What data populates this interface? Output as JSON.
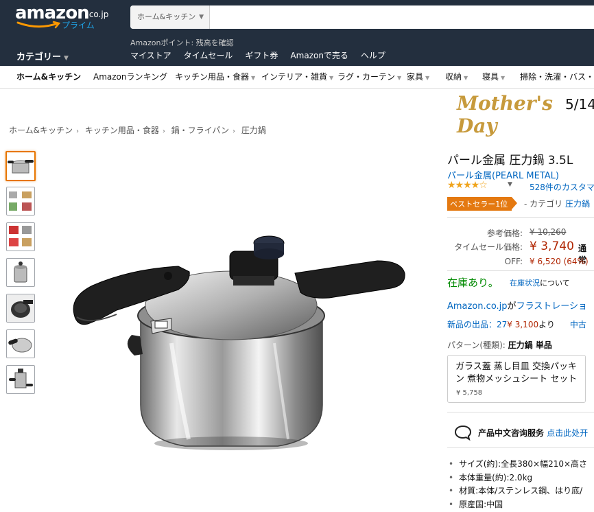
{
  "header": {
    "logo_word": "amazon",
    "logo_tld": ".co.jp",
    "logo_prime": "プライム",
    "search_department": "ホーム&キッチン",
    "search_placeholder": "",
    "points_text": "Amazonポイント: 残高を確認",
    "category_label": "カテゴリー",
    "nav_links": [
      "マイストア",
      "タイムセール",
      "ギフト券",
      "Amazonで売る",
      "ヘルプ"
    ]
  },
  "subnav": {
    "items": [
      "ホーム&キッチン",
      "Amazonランキング",
      "キッチン用品・食器",
      "インテリア・雑貨",
      "ラグ・カーテン",
      "家具",
      "収納",
      "寝具",
      "掃除・洗濯・バス・トイ"
    ]
  },
  "banner": {
    "title": "Mother's Day",
    "date": "5/14"
  },
  "breadcrumb": [
    "ホーム&キッチン",
    "キッチン用品・食器",
    "鍋・フライパン",
    "圧力鍋"
  ],
  "product": {
    "title": "パール金属 圧力鍋 3.5L",
    "brand": "パール金属(PEARL METAL)",
    "rating": 4.0,
    "stars_filled": "★★★★",
    "stars_empty": "☆",
    "review_count": "528件のカスタマ",
    "bestseller_badge": "ベストセラー1位",
    "bestseller_category_prefix": "- カテゴリ",
    "bestseller_category": "圧力鍋",
    "list_price_label": "参考価格:",
    "list_price": "¥ 10,260",
    "sale_price_label": "タイムセール価格:",
    "sale_price": "¥ 3,740",
    "regular_text": "通常",
    "off_label": "OFF:",
    "off_value": "¥ 6,520 (64%)",
    "stock_text": "在庫あり。",
    "stock_link": "在庫状況",
    "stock_suffix": "について",
    "frustration_prefix": "Amazon.co.jp",
    "frustration_mid": "が",
    "frustration_link": "フラストレーショ",
    "new_offers_link": "新品の出品：27",
    "new_offers_price": "¥ 3,100",
    "new_offers_suffix": "より",
    "new_offers_mid": "中古",
    "pattern_label": "パターン(種類):",
    "pattern_value": "圧力鍋 単品",
    "accessory_title": "ガラス蓋 蒸し目皿 交換パッキン 煮物メッシュシート セット",
    "accessory_price": "¥ 5,758",
    "chat_label": "产品中文咨询服务",
    "chat_link": "点击此处开",
    "specs": [
      "サイズ(約):全長380×幅210×高さ",
      "本体重量(約):2.0kg",
      "材質:本体/ステンレス鋼、はり底/",
      "原産国:中国"
    ]
  },
  "colors": {
    "header_bg": "#232f3e",
    "link": "#0066c0",
    "price": "#b12704",
    "in_stock": "#008a00",
    "badge": "#e47911",
    "star": "#f0a41c",
    "banner_gold": "#c79a3c"
  },
  "icons": {
    "thumbnails": [
      "pot-side-icon",
      "pot-parts-icon",
      "pot-features-icon",
      "pot-top-icon",
      "pot-lid-icon",
      "pot-handle-icon",
      "pot-open-icon"
    ],
    "chat": "chat-bubble-icon"
  }
}
